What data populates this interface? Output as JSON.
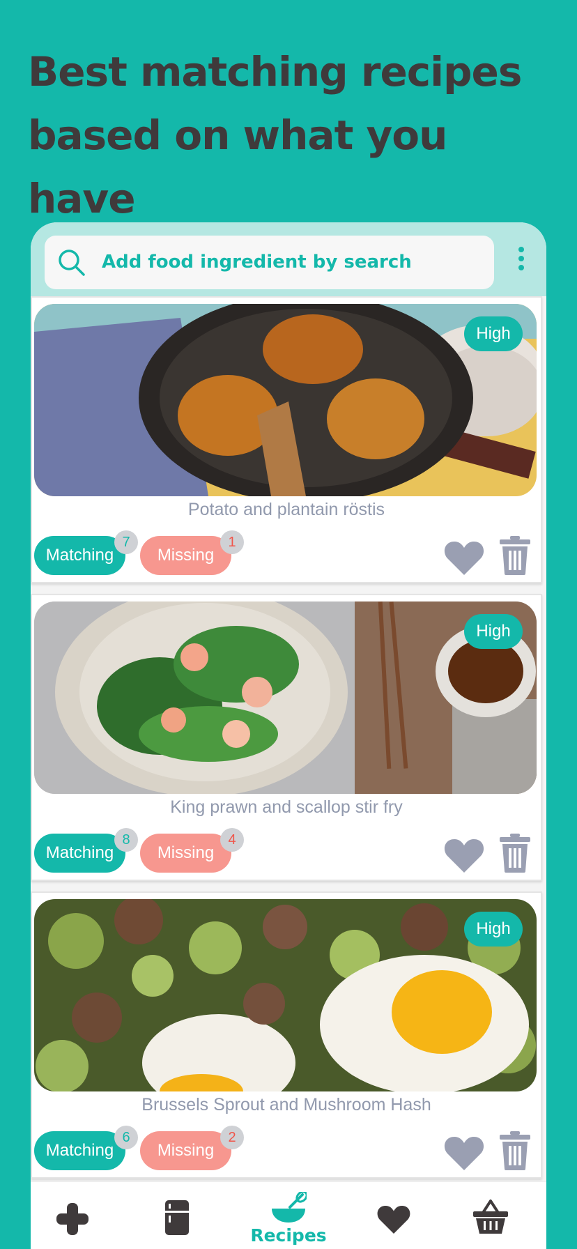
{
  "header": {
    "title_line1": "Best matching recipes",
    "title_line2": "based on what you have"
  },
  "search": {
    "placeholder": "Add food ingredient by search",
    "icon": "search-icon",
    "menu_icon": "more-vertical-icon"
  },
  "colors": {
    "accent": "#14b8aa",
    "missing": "#f7978f",
    "icon_gray": "#9a9fb2",
    "headline": "#3f3a3b"
  },
  "recipes": [
    {
      "title": "Potato and plantain röstis",
      "level": "High",
      "matching_label": "Matching",
      "matching_count": "7",
      "missing_label": "Missing",
      "missing_count": "1"
    },
    {
      "title": "King prawn and scallop stir fry",
      "level": "High",
      "matching_label": "Matching",
      "matching_count": "8",
      "missing_label": "Missing",
      "missing_count": "4"
    },
    {
      "title": "Brussels Sprout and Mushroom Hash",
      "level": "High",
      "matching_label": "Matching",
      "matching_count": "6",
      "missing_label": "Missing",
      "missing_count": "2"
    }
  ],
  "nav": {
    "items": [
      {
        "icon": "plus-icon",
        "label": ""
      },
      {
        "icon": "fridge-icon",
        "label": ""
      },
      {
        "icon": "recipes-bowl-icon",
        "label": "Recipes",
        "active": true
      },
      {
        "icon": "heart-icon",
        "label": ""
      },
      {
        "icon": "basket-icon",
        "label": ""
      }
    ]
  }
}
